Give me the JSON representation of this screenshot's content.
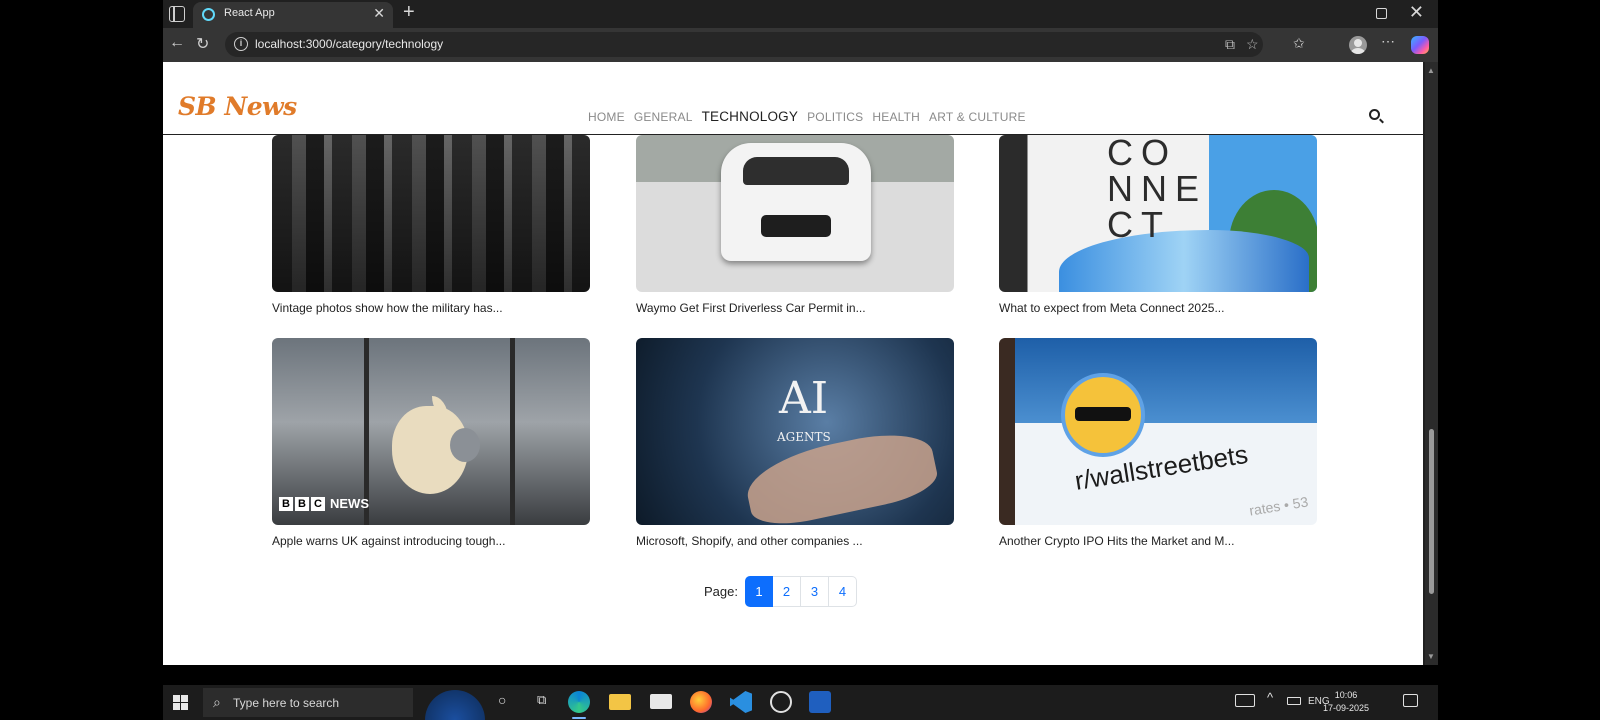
{
  "browser": {
    "tab_title": "React App",
    "new_tab_glyph": "+",
    "close_glyph": "✕",
    "url": "localhost:3000/category/technology"
  },
  "site": {
    "logo": "SB News",
    "nav": [
      "HOME",
      "GENERAL",
      "TECHNOLOGY",
      "POLITICS",
      "HEALTH",
      "ART & CULTURE"
    ],
    "active_nav": "TECHNOLOGY"
  },
  "articles": [
    {
      "title": "Vintage photos show how the military has...",
      "image": "vintage-military-photo"
    },
    {
      "title": "Waymo Get First Driverless Car Permit in...",
      "image": "waymo-car-photo"
    },
    {
      "title": "What to expect from Meta Connect 2025...",
      "image": "meta-connect-photo"
    },
    {
      "title": "Apple warns UK against introducing tough...",
      "image": "apple-logo-photo"
    },
    {
      "title": "Microsoft, Shopify, and other companies ...",
      "image": "ai-agents-photo"
    },
    {
      "title": "Another Crypto IPO Hits the Market and M...",
      "image": "wallstreetbets-photo"
    }
  ],
  "image_text": {
    "meta": "CO\nNNE\nCT",
    "bbc_letters": [
      "B",
      "B",
      "C"
    ],
    "bbc_news": "NEWS",
    "ai": "AI",
    "ai_sub": "AGENTS",
    "wsb": "r/wallstreetbets",
    "wsb_sub": "rates • 53"
  },
  "pagination": {
    "label": "Page:",
    "pages": [
      "1",
      "2",
      "3",
      "4"
    ],
    "current": "1"
  },
  "taskbar": {
    "search_placeholder": "Type here to search",
    "language": "ENG",
    "time": "10:06",
    "date": "17-09-2025"
  },
  "colors": {
    "logo": "#e07b2a",
    "accent": "#0d6efd",
    "browser_chrome": "#202020",
    "taskbar": "#1c1c1c"
  }
}
